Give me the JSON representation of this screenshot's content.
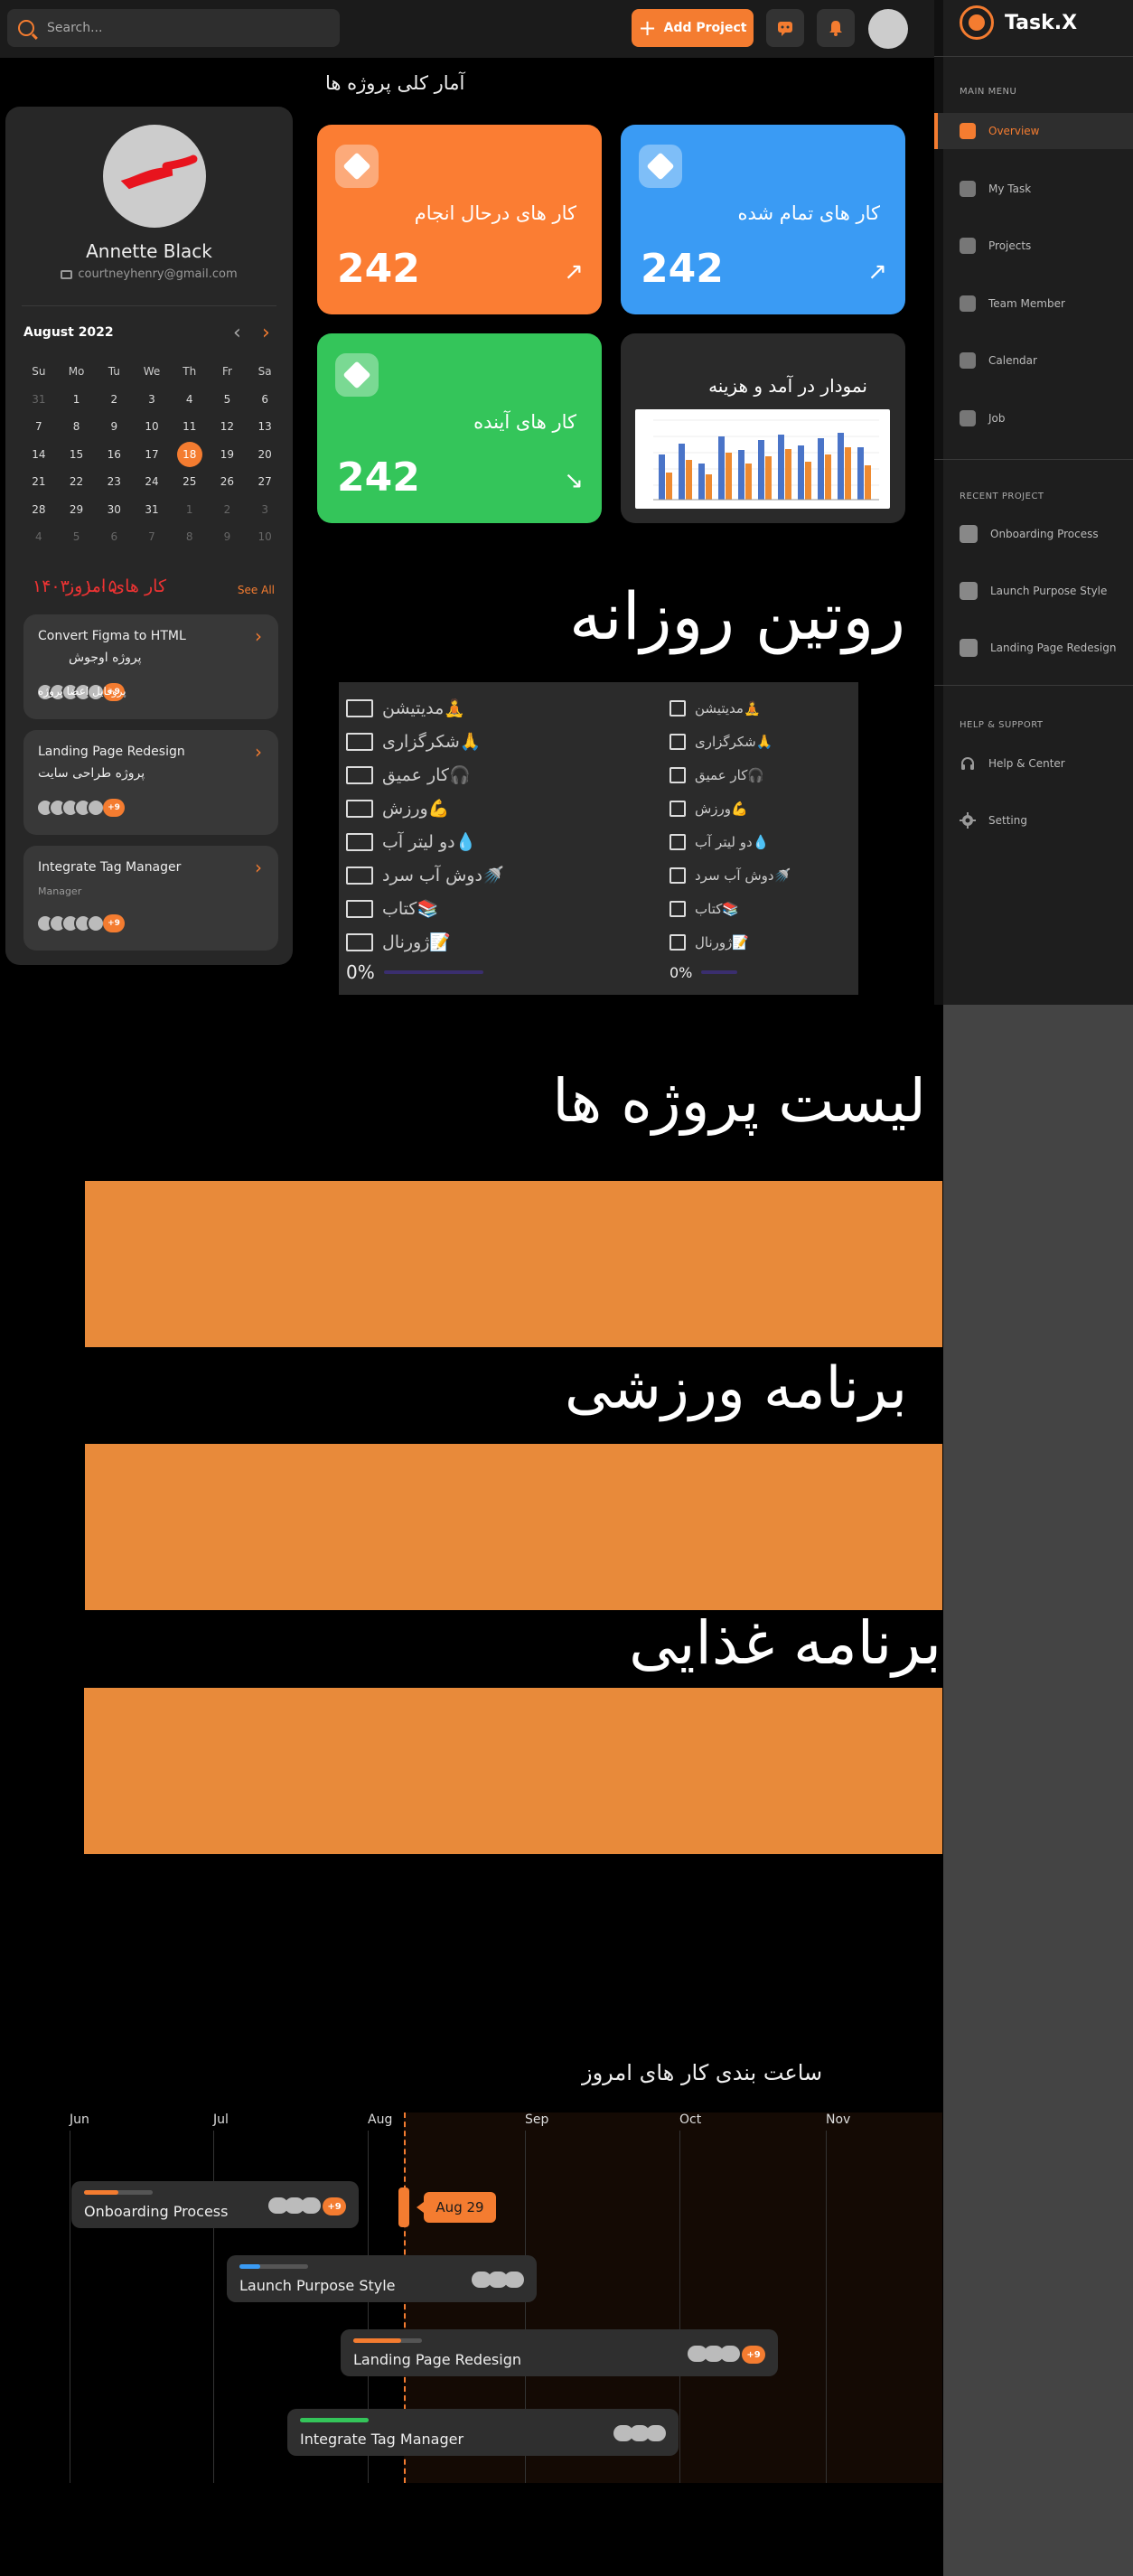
{
  "topbar": {
    "search_placeholder": "Search...",
    "add_project_label": "Add Project"
  },
  "sidebar": {
    "brand": "Task.X",
    "main_menu_title": "MAIN MENU",
    "main_menu": [
      {
        "label": "Overview",
        "icon": "grid-icon",
        "active": true
      },
      {
        "label": "My Task",
        "icon": "shield-icon"
      },
      {
        "label": "Projects",
        "icon": "cubes-icon"
      },
      {
        "label": "Team Member",
        "icon": "team-icon"
      },
      {
        "label": "Calendar",
        "icon": "calendar-icon"
      },
      {
        "label": "Job",
        "icon": "chart-icon"
      }
    ],
    "recent_title": "RECENT PROJECT",
    "recent": [
      {
        "label": "Onboarding Process"
      },
      {
        "label": "Launch Purpose Style"
      },
      {
        "label": "Landing Page Redesign"
      }
    ],
    "help_title": "HELP & SUPPORT",
    "help": [
      {
        "label": "Help & Center",
        "icon": "headset-icon"
      },
      {
        "label": "Setting",
        "icon": "gear-icon"
      }
    ]
  },
  "profile": {
    "name": "Annette Black",
    "email": "courtneyhenry@gmail.com"
  },
  "calendar": {
    "month_label": "August 2022",
    "weekdays": [
      "Su",
      "Mo",
      "Tu",
      "We",
      "Th",
      "Fr",
      "Sa"
    ],
    "days": [
      {
        "d": "31",
        "m": true
      },
      {
        "d": "1"
      },
      {
        "d": "2"
      },
      {
        "d": "3"
      },
      {
        "d": "4"
      },
      {
        "d": "5"
      },
      {
        "d": "6"
      },
      {
        "d": "7"
      },
      {
        "d": "8"
      },
      {
        "d": "9"
      },
      {
        "d": "10"
      },
      {
        "d": "11"
      },
      {
        "d": "12"
      },
      {
        "d": "13"
      },
      {
        "d": "14"
      },
      {
        "d": "15"
      },
      {
        "d": "16"
      },
      {
        "d": "17"
      },
      {
        "d": "18",
        "t": true
      },
      {
        "d": "19"
      },
      {
        "d": "20"
      },
      {
        "d": "21"
      },
      {
        "d": "22"
      },
      {
        "d": "23"
      },
      {
        "d": "24"
      },
      {
        "d": "25"
      },
      {
        "d": "26"
      },
      {
        "d": "27"
      },
      {
        "d": "28"
      },
      {
        "d": "29"
      },
      {
        "d": "30"
      },
      {
        "d": "31"
      },
      {
        "d": "1",
        "m": true
      },
      {
        "d": "2",
        "m": true
      },
      {
        "d": "3",
        "m": true
      },
      {
        "d": "4",
        "m": true
      },
      {
        "d": "5",
        "m": true
      },
      {
        "d": "6",
        "m": true
      },
      {
        "d": "7",
        "m": true
      },
      {
        "d": "8",
        "m": true
      },
      {
        "d": "9",
        "m": true
      },
      {
        "d": "10",
        "m": true
      }
    ]
  },
  "today_tasks": {
    "title": "کار های امروز",
    "date": "۱۴۰۳.۰۱.۰۵",
    "see_all": "See All",
    "items": [
      {
        "title": "Convert Figma to HTML",
        "subtitle": "پروژه اوجوش",
        "overlap_text": "پروفایل اعضا پروژه",
        "extra": "+9"
      },
      {
        "title": "Landing Page Redesign",
        "subtitle": "پروژه طراحی سایت",
        "extra": "+9"
      },
      {
        "title": "Integrate Tag Manager",
        "subtitle": "Manager",
        "extra": "+9"
      }
    ]
  },
  "stats": {
    "title": "آمار کلی پروژه ها",
    "cards": [
      {
        "label": "کار های درحال انجام",
        "value": "242",
        "color": "#fb7d33",
        "trend": "up"
      },
      {
        "label": "کار های تمام شده",
        "value": "242",
        "color": "#3a9bf4",
        "trend": "up"
      },
      {
        "label": "کار های آینده",
        "value": "242",
        "color": "#34c55a",
        "trend": "down"
      },
      {
        "label": "نمودار در آمد و هزینه",
        "color": "#2a2a2a"
      }
    ]
  },
  "routine": {
    "title": "روتین روزانه",
    "left": [
      "مدیتیشن🧘",
      "شکرگزاری🙏",
      "کار عمیق🎧",
      "ورزش💪",
      "دو لیتر آب💧",
      "دوش آب سرد🚿",
      "کتاب📚",
      "ژورنال📝"
    ],
    "right": [
      "مدیتیشن🧘",
      "شکرگزاری🙏",
      "کار عمیق🎧",
      "ورزش💪",
      "دو لیتر آب💧",
      "دوش آب سرد🚿",
      "کتاب📚",
      "ژورنال📝"
    ],
    "left_percent": "0%",
    "right_percent": "0%"
  },
  "sections": {
    "projects_list": "لیست پروژه ها",
    "workout": "برنامه ورزشی",
    "diet": "برنامه غذایی"
  },
  "timeline": {
    "title": "ساعت بندی کار های امروز",
    "months": [
      "Jun",
      "Jul",
      "Aug",
      "Sep",
      "Oct",
      "Nov"
    ],
    "today_flag": "Aug 29",
    "bars": [
      {
        "label": "Onboarding Process",
        "extra": "+9",
        "color": "#f47c30"
      },
      {
        "label": "Launch Purpose Style",
        "color": "#3a9bf4"
      },
      {
        "label": "Landing Page Redesign",
        "extra": "+9",
        "color": "#f47c30"
      },
      {
        "label": "Integrate Tag Manager",
        "color": "#34c55a"
      }
    ]
  }
}
